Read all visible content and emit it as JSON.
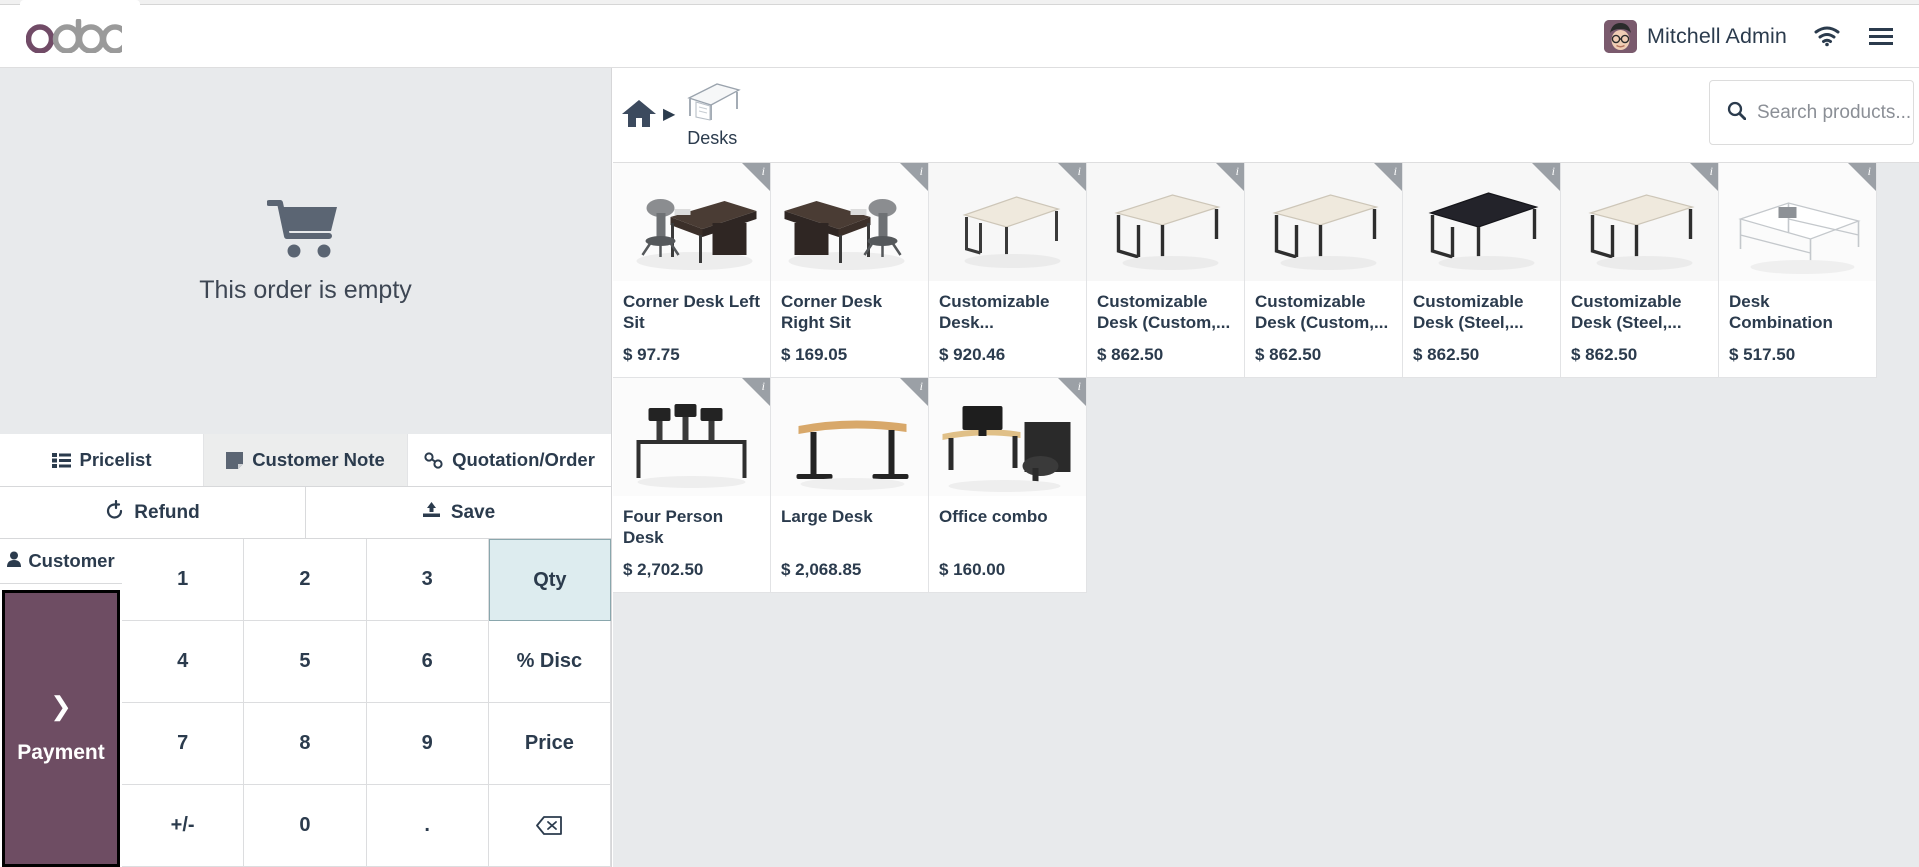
{
  "header": {
    "logo_text": "odoo",
    "user_name": "Mitchell Admin",
    "avatar_icon": "user-avatar",
    "wifi_icon": "wifi-icon",
    "menu_icon": "hamburger-menu-icon"
  },
  "order_panel": {
    "empty_icon": "shopping-cart-icon",
    "empty_text": "This order is empty",
    "tabs": [
      {
        "label": "Pricelist",
        "icon": "list-icon",
        "active": false
      },
      {
        "label": "Customer Note",
        "icon": "note-icon",
        "active": true
      },
      {
        "label": "Quotation/Order",
        "icon": "link-icon",
        "active": false
      }
    ],
    "actions": [
      {
        "label": "Refund",
        "icon": "undo-icon"
      },
      {
        "label": "Save",
        "icon": "upload-icon"
      }
    ],
    "customer_button": {
      "label": "Customer",
      "icon": "person-icon"
    },
    "payment_button": {
      "label": "Payment",
      "icon": "chevron-right-icon"
    },
    "numpad": {
      "keys": [
        "1",
        "2",
        "3",
        "4",
        "5",
        "6",
        "7",
        "8",
        "9",
        "+/-",
        "0",
        "."
      ],
      "modes": [
        {
          "label": "Qty",
          "selected": true
        },
        {
          "label": "% Disc",
          "selected": false
        },
        {
          "label": "Price",
          "selected": false
        },
        {
          "label": "",
          "icon": "backspace-icon",
          "selected": false
        }
      ]
    }
  },
  "products_panel": {
    "breadcrumb": {
      "home_icon": "home-icon",
      "separator": "▶",
      "category": "Desks"
    },
    "search": {
      "icon": "search-icon",
      "placeholder": "Search products...",
      "value": ""
    },
    "products": [
      {
        "name": "Corner Desk Left Sit",
        "price": "$ 97.75",
        "image": "corner-desk-left"
      },
      {
        "name": "Corner Desk Right Sit",
        "price": "$ 169.05",
        "image": "corner-desk-right"
      },
      {
        "name": "Customizable Desk...",
        "price": "$ 920.46",
        "image": "plain-desk-white"
      },
      {
        "name": "Customizable Desk (Custom,...",
        "price": "$ 862.50",
        "image": "plain-desk-white"
      },
      {
        "name": "Customizable Desk (Custom,...",
        "price": "$ 862.50",
        "image": "plain-desk-white"
      },
      {
        "name": "Customizable Desk (Steel,...",
        "price": "$ 862.50",
        "image": "plain-desk-black"
      },
      {
        "name": "Customizable Desk (Steel,...",
        "price": "$ 862.50",
        "image": "plain-desk-white"
      },
      {
        "name": "Desk Combination",
        "price": "$ 517.50",
        "image": "desk-combination"
      },
      {
        "name": "Four Person Desk",
        "price": "$ 2,702.50",
        "image": "four-person-desk"
      },
      {
        "name": "Large Desk",
        "price": "$ 2,068.85",
        "image": "large-desk"
      },
      {
        "name": "Office combo",
        "price": "$ 160.00",
        "image": "office-combo"
      }
    ],
    "info_badge": "i"
  },
  "colors": {
    "brand_purple": "#6e4d63",
    "panel_gray": "#e8eaec",
    "text_dark": "#2b3b4d",
    "selected_blue": "#ddecef"
  }
}
